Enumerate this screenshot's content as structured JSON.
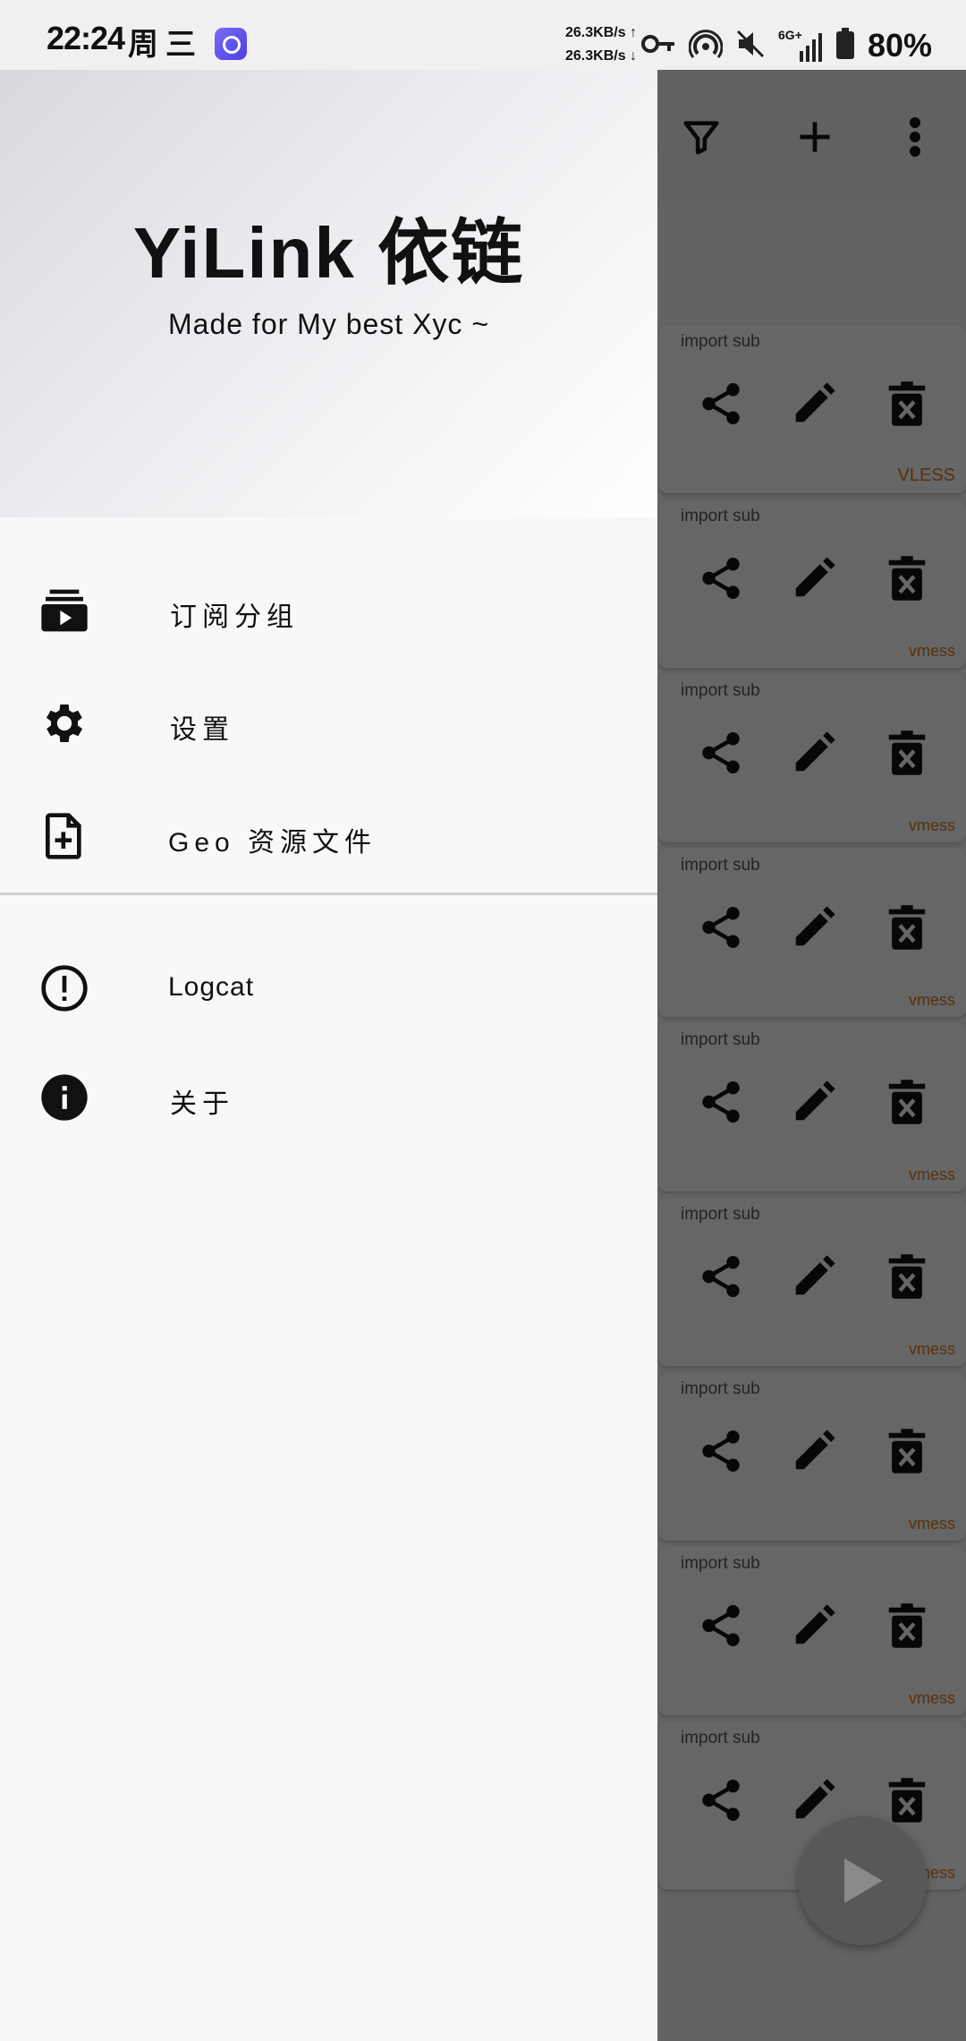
{
  "status_bar": {
    "time": "22:24",
    "day": "周三",
    "net_up": "26.3KB/s ↑",
    "net_down": "26.3KB/s ↓",
    "signal_label": "6G+",
    "battery": "80%"
  },
  "drawer": {
    "title": "YiLink 依链",
    "subtitle": "Made for My best Xyc ~",
    "items": [
      {
        "label": "订阅分组",
        "icon": "subscriptions-icon"
      },
      {
        "label": "设置",
        "icon": "settings-gear-icon"
      },
      {
        "label": "Geo 资源文件",
        "icon": "add-file-icon"
      },
      {
        "label": "Logcat",
        "icon": "alert-circle-icon"
      },
      {
        "label": "关于",
        "icon": "info-icon"
      }
    ]
  },
  "background": {
    "toolbar_icons": [
      "filter-icon",
      "add-icon",
      "more-vert-icon"
    ],
    "cards": [
      {
        "subtitle": "import sub",
        "type": "VLESS"
      },
      {
        "subtitle": "import sub",
        "type": "vmess"
      },
      {
        "subtitle": "import sub",
        "type": "vmess"
      },
      {
        "subtitle": "import sub",
        "type": "vmess"
      },
      {
        "subtitle": "import sub",
        "type": "vmess"
      },
      {
        "subtitle": "import sub",
        "type": "vmess"
      },
      {
        "subtitle": "import sub",
        "type": "vmess"
      },
      {
        "subtitle": "import sub",
        "type": "vmess"
      },
      {
        "subtitle": "import sub",
        "type": "vmess"
      }
    ],
    "card_actions": [
      "share-icon",
      "edit-icon",
      "delete-icon"
    ],
    "fab_icon": "play-icon"
  },
  "colors": {
    "protocol_label": "#d4731f",
    "scrim": "#000000"
  }
}
